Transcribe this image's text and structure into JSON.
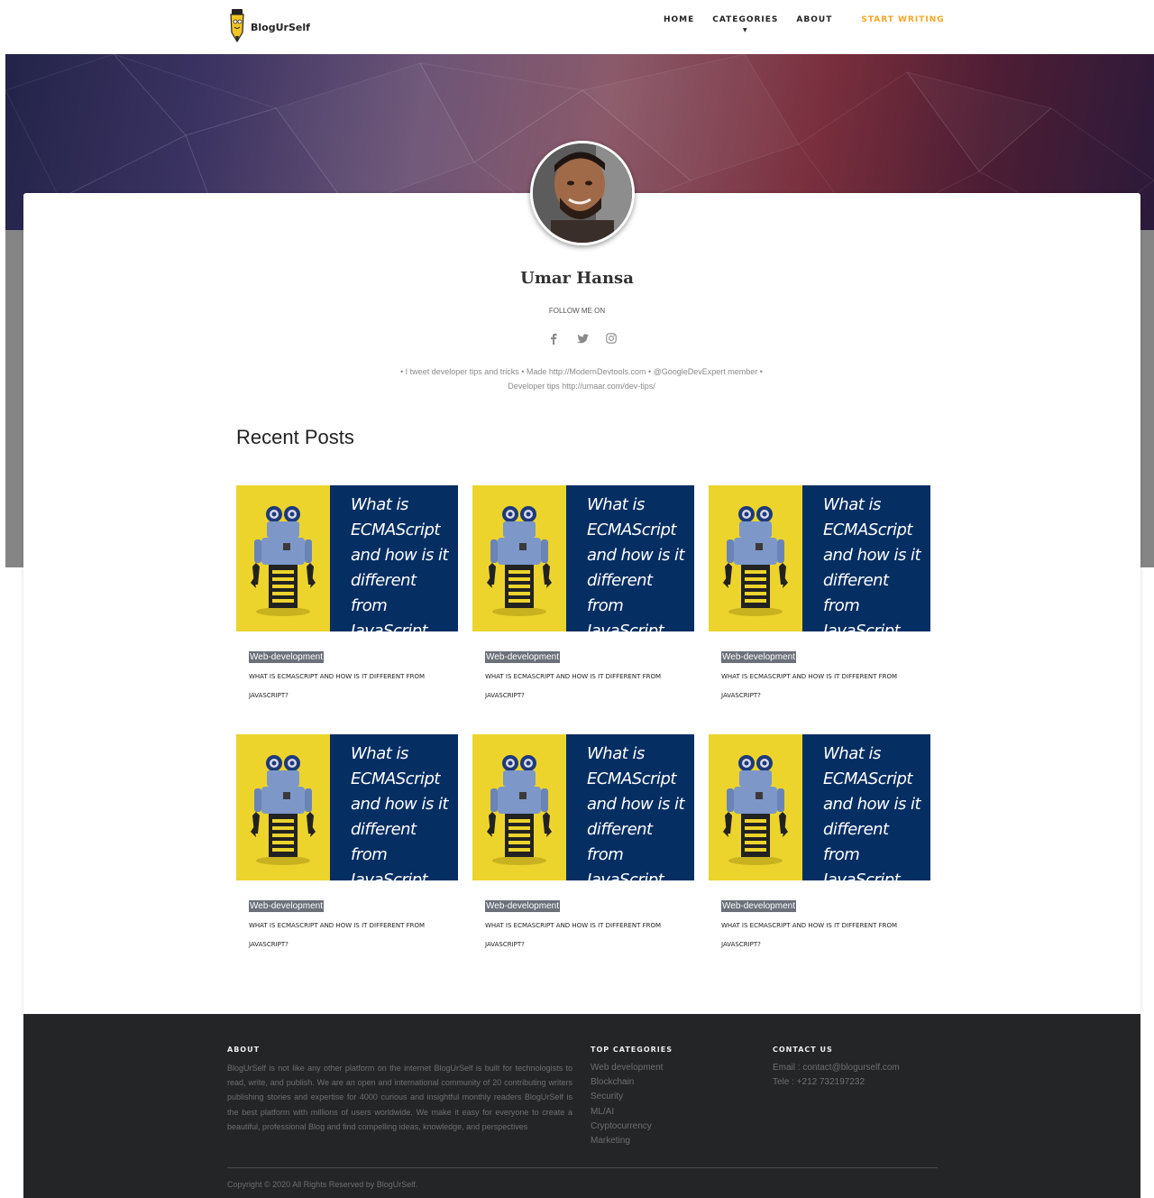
{
  "brand": {
    "name": "BlogUrSelf"
  },
  "nav": {
    "items": [
      {
        "label": "HOME"
      },
      {
        "label": "CATEGORIES"
      },
      {
        "label": "ABOUT"
      }
    ],
    "cta_label": "START WRITING",
    "caret": "▼"
  },
  "profile": {
    "name": "Umar Hansa",
    "follow_label": "FOLLOW ME ON",
    "socials": [
      "facebook-icon",
      "twitter-icon",
      "instagram-icon"
    ],
    "bio": "• I tweet developer tips and tricks • Made http://ModernDevtools.com • @GoogleDevExpert member • Developer tips http://umaar.com/dev-tips/"
  },
  "recent": {
    "title": "Recent Posts",
    "posts": [
      {
        "thumb_title": "What is ECMAScript and how is it different from JavaScript",
        "tag": "Web-development",
        "title": "WHAT IS ECMASCRIPT AND HOW IS IT DIFFERENT FROM JAVASCRIPT?"
      },
      {
        "thumb_title": "What is ECMAScript and how is it different from JavaScript",
        "tag": "Web-development",
        "title": "WHAT IS ECMASCRIPT AND HOW IS IT DIFFERENT FROM JAVASCRIPT?"
      },
      {
        "thumb_title": "What is ECMAScript and how is it different from JavaScript",
        "tag": "Web-development",
        "title": "WHAT IS ECMASCRIPT AND HOW IS IT DIFFERENT FROM JAVASCRIPT?"
      },
      {
        "thumb_title": "What is ECMAScript and how is it different from JavaScript",
        "tag": "Web-development",
        "title": "WHAT IS ECMASCRIPT AND HOW IS IT DIFFERENT FROM JAVASCRIPT?"
      },
      {
        "thumb_title": "What is ECMAScript and how is it different from JavaScript",
        "tag": "Web-development",
        "title": "WHAT IS ECMASCRIPT AND HOW IS IT DIFFERENT FROM JAVASCRIPT?"
      },
      {
        "thumb_title": "What is ECMAScript and how is it different from JavaScript",
        "tag": "Web-development",
        "title": "WHAT IS ECMASCRIPT AND HOW IS IT DIFFERENT FROM JAVASCRIPT?"
      }
    ]
  },
  "footer": {
    "about_title": "ABOUT",
    "about_text": "BlogUrSelf is not like any other platform on the internet BlogUrSelf is built for technologists to read, write, and publish. We are an open and international community of 20 contributing writers publishing stories and expertise for 4000 curious and insightful monthly readers BlogUrSelf is the best platform with millions of users worldwide. We make it easy for everyone to create a beautiful, professional Blog and find compelling ideas, knowledge, and perspectives",
    "categories_title": "TOP CATEGORIES",
    "categories": [
      "Web development",
      "Blockchain",
      "Security",
      "ML/AI",
      "Cryptocurrency",
      "Marketing"
    ],
    "contact_title": "CONTACT US",
    "contact": [
      "Email : contact@blogurself.com",
      "Tele : +212 732197232"
    ],
    "copyright": "Copyright © 2020 All Rights Reserved by BlogUrSelf."
  },
  "colors": {
    "accent": "#f5a623",
    "footer_bg": "#232527",
    "thumb_yellow": "#ecd42c",
    "thumb_navy": "#052e63",
    "tag_bg": "#6b7079"
  }
}
